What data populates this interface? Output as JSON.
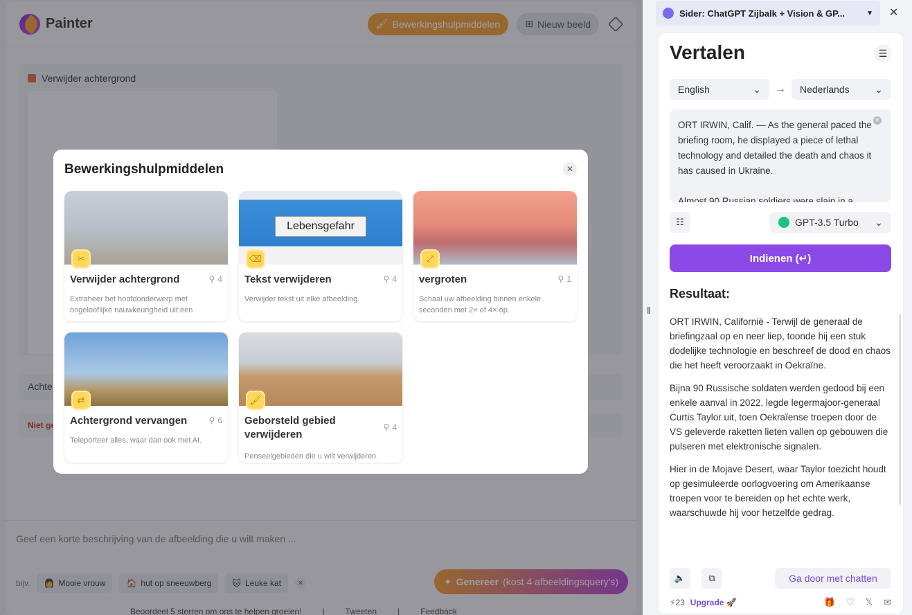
{
  "app": {
    "brand": "Painter",
    "tools_btn": "Bewerkingshulpmiddelen",
    "new_image_btn": "Nieuw beeld",
    "work_title": "Verwijder achtergrond",
    "strip_text": "Achte",
    "strip2_text": "Niet ge",
    "prompt_placeholder": "Geef een korte beschrijving van de afbeelding die u wilt maken ...",
    "examples_label": "bijv.",
    "chips": [
      "Mooie vrouw",
      "hut op sneeuwberg",
      "Leuke kat"
    ],
    "generate_label": "Genereer",
    "generate_cost": "(kost 4 afbeeldingsquery's)",
    "footer": [
      "Beoordeel 5 sterren om ons te helpen groeien!",
      "|",
      "Tweeten",
      "|",
      "Feedback"
    ]
  },
  "modal": {
    "title": "Bewerkingshulpmiddelen",
    "cards": [
      {
        "title": "Verwijder achtergrond",
        "count": "4",
        "desc": "Extraheer het hoofdonderwerp met ongelooflijke nauwkeurigheid uit een afbeelding."
      },
      {
        "title": "Tekst verwijderen",
        "count": "4",
        "desc": "Verwijder tekst uit elke afbeelding.",
        "sign": "Lebensgefahr"
      },
      {
        "title": "vergroten",
        "count": "1",
        "desc": "Schaal uw afbeelding binnen enkele seconden met 2× of 4× op."
      },
      {
        "title": "Achtergrond vervangen",
        "count": "6",
        "desc": "Teleporteer alles, waar dan ook met AI."
      },
      {
        "title": "Geborsteld gebied verwijderen",
        "count": "4",
        "desc": "Penseelgebieden die u wilt verwijderen."
      }
    ]
  },
  "sidebar": {
    "tab_title": "Sider: ChatGPT Zijbalk + Vision & GP...",
    "heading": "Vertalen",
    "source_lang": "English",
    "target_lang": "Nederlands",
    "input_text_1": "ORT IRWIN, Calif. — As the general paced the briefing room, he displayed a piece of lethal technology and detailed the death and chaos it has caused in Ukraine.",
    "input_text_2": "Almost 90 Russian soldiers were slain in a",
    "model": "GPT-3.5 Turbo",
    "submit": "Indienen (↵)",
    "result_title": "Resultaat:",
    "result_paragraphs": [
      "ORT IRWIN, Californië - Terwijl de generaal de briefingzaal op en neer liep, toonde hij een stuk dodelijke technologie en beschreef de dood en chaos die het heeft veroorzaakt in Oekraïne.",
      "Bijna 90 Russische soldaten werden gedood bij een enkele aanval in 2022, legde legermajoor-generaal Curtis Taylor uit, toen Oekraïense troepen door de VS geleverde raketten lieten vallen op gebouwen die pulseren met elektronische signalen.",
      "Hier in de Mojave Desert, waar Taylor toezicht houdt op gesimuleerde oorlogvoering om Amerikaanse troepen voor te bereiden op het echte werk, waarschuwde hij voor hetzelfde gedrag."
    ],
    "continue_chat": "Ga door met chatten",
    "credits": "23",
    "upgrade": "Upgrade"
  },
  "colors": {
    "accent_orange": "#f39b2f",
    "accent_purple": "#8b4ae8"
  }
}
